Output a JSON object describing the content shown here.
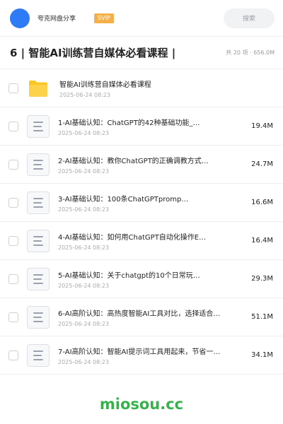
{
  "header": {
    "user_name": "夸克网盘分享",
    "vip_badge": "SVIP",
    "search_placeholder": "搜索"
  },
  "folder": {
    "title": "6 | 智能AI训练营自媒体必看课程 |",
    "meta": "共 20 项 · 656.0M"
  },
  "files": [
    {
      "name": "智能AI训练营自媒体必看课程",
      "date": "2025-06-24 08:23",
      "size": "",
      "type": "folder"
    },
    {
      "name": "1-AI基础认知：ChatGPT的42种基础功能_…",
      "date": "2025-06-24 08:23",
      "size": "19.4M",
      "type": "doc"
    },
    {
      "name": "2-AI基础认知：教你ChatGPT的正确调教方式…",
      "date": "2025-06-24 08:23",
      "size": "24.7M",
      "type": "doc"
    },
    {
      "name": "3-AI基础认知：100条ChatGPTpromp…",
      "date": "2025-06-24 08:23",
      "size": "16.6M",
      "type": "doc"
    },
    {
      "name": "4-AI基础认知：如何用ChatGPT自动化操作E…",
      "date": "2025-06-24 08:23",
      "size": "16.4M",
      "type": "doc"
    },
    {
      "name": "5-AI基础认知：关于chatgpt的10个日常玩…",
      "date": "2025-06-24 08:23",
      "size": "29.3M",
      "type": "doc"
    },
    {
      "name": "6-AI高阶认知：高热度智能AI工具对比，选择适合…",
      "date": "2025-06-24 08:23",
      "size": "51.1M",
      "type": "doc"
    },
    {
      "name": "7-AI高阶认知：智能AI提示词工具用起来，节省一…",
      "date": "2025-06-24 08:23",
      "size": "34.1M",
      "type": "doc"
    }
  ],
  "watermark": "miosou.cc",
  "colors": {
    "avatar": "#2f7bf5",
    "vip": "#f6b04a",
    "folder": "#f9c623",
    "watermark": "#35b34a"
  }
}
